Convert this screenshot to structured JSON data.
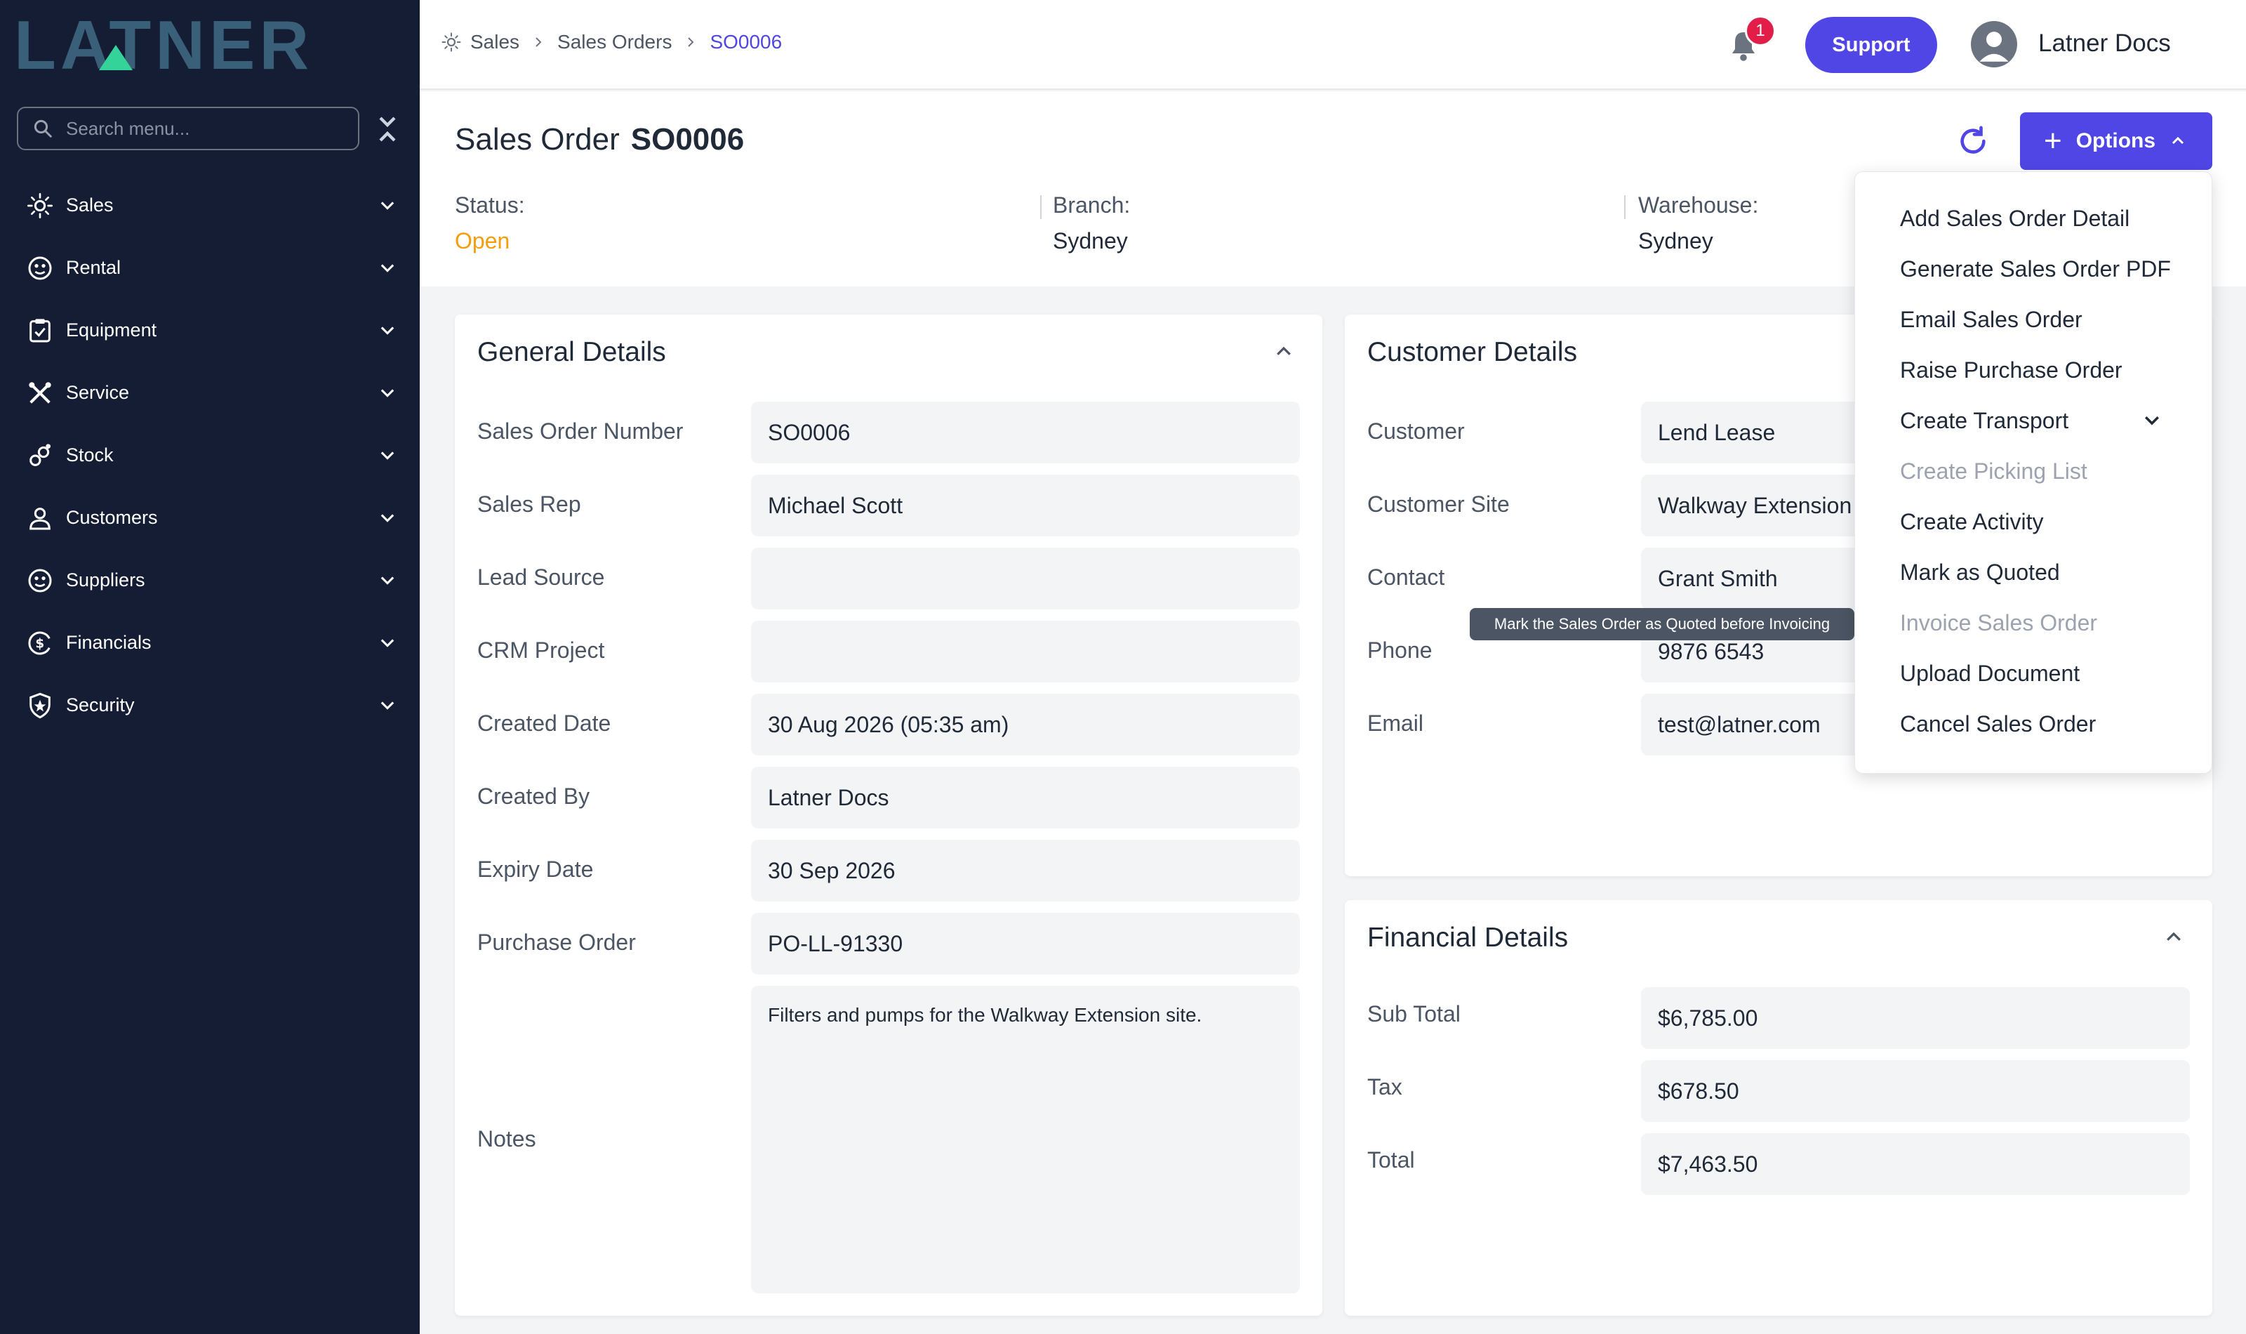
{
  "brand": {
    "logo_text": "LATNER",
    "accent": "#4f46e5",
    "sidebar_bg": "#141d33"
  },
  "sidebar": {
    "search_placeholder": "Search menu...",
    "items": [
      {
        "label": "Sales",
        "icon": "sales-icon"
      },
      {
        "label": "Rental",
        "icon": "rental-icon"
      },
      {
        "label": "Equipment",
        "icon": "equipment-icon"
      },
      {
        "label": "Service",
        "icon": "service-icon"
      },
      {
        "label": "Stock",
        "icon": "stock-icon"
      },
      {
        "label": "Customers",
        "icon": "customers-icon"
      },
      {
        "label": "Suppliers",
        "icon": "suppliers-icon"
      },
      {
        "label": "Financials",
        "icon": "financials-icon"
      },
      {
        "label": "Security",
        "icon": "security-icon"
      }
    ]
  },
  "topbar": {
    "breadcrumb": [
      "Sales",
      "Sales Orders",
      "SO0006"
    ],
    "notification_count": "1",
    "support_label": "Support",
    "user_name": "Latner Docs"
  },
  "header": {
    "title": "Sales Order",
    "order_number": "SO0006",
    "options_label": "Options",
    "status_label": "Status:",
    "status_value": "Open",
    "branch_label": "Branch:",
    "branch_value": "Sydney",
    "warehouse_label": "Warehouse:",
    "warehouse_value": "Sydney"
  },
  "general": {
    "title": "General Details",
    "rows": [
      {
        "label": "Sales Order Number",
        "value": "SO0006"
      },
      {
        "label": "Sales Rep",
        "value": "Michael Scott"
      },
      {
        "label": "Lead Source",
        "value": ""
      },
      {
        "label": "CRM Project",
        "value": ""
      },
      {
        "label": "Created Date",
        "value": "30 Aug 2026 (05:35 am)"
      },
      {
        "label": "Created By",
        "value": "Latner Docs"
      },
      {
        "label": "Expiry Date",
        "value": "30 Sep 2026"
      },
      {
        "label": "Purchase Order",
        "value": "PO-LL-91330"
      }
    ],
    "notes_label": "Notes",
    "notes_value": "Filters and pumps for the Walkway Extension site."
  },
  "customer": {
    "title": "Customer Details",
    "rows": [
      {
        "label": "Customer",
        "value": "Lend Lease"
      },
      {
        "label": "Customer Site",
        "value": "Walkway Extension"
      },
      {
        "label": "Contact",
        "value": "Grant Smith"
      },
      {
        "label": "Phone",
        "value": "9876 6543"
      },
      {
        "label": "Email",
        "value": "test@latner.com"
      }
    ]
  },
  "financial": {
    "title": "Financial Details",
    "rows": [
      {
        "label": "Sub Total",
        "value": "$6,785.00"
      },
      {
        "label": "Tax",
        "value": "$678.50"
      },
      {
        "label": "Total",
        "value": "$7,463.50"
      }
    ]
  },
  "options_menu": {
    "items": [
      {
        "label": "Add Sales Order Detail",
        "disabled": false
      },
      {
        "label": "Generate Sales Order PDF",
        "disabled": false
      },
      {
        "label": "Email Sales Order",
        "disabled": false
      },
      {
        "label": "Raise Purchase Order",
        "disabled": false
      },
      {
        "label": "Create Transport",
        "disabled": false,
        "submenu": true
      },
      {
        "label": "Create Picking List",
        "disabled": true
      },
      {
        "label": "Create Activity",
        "disabled": false
      },
      {
        "label": "Mark as Quoted",
        "disabled": false
      },
      {
        "label": "Invoice Sales Order",
        "disabled": true
      },
      {
        "label": "Upload Document",
        "disabled": false
      },
      {
        "label": "Cancel Sales Order",
        "disabled": false
      }
    ],
    "tooltip": "Mark the Sales Order as Quoted before Invoicing"
  }
}
